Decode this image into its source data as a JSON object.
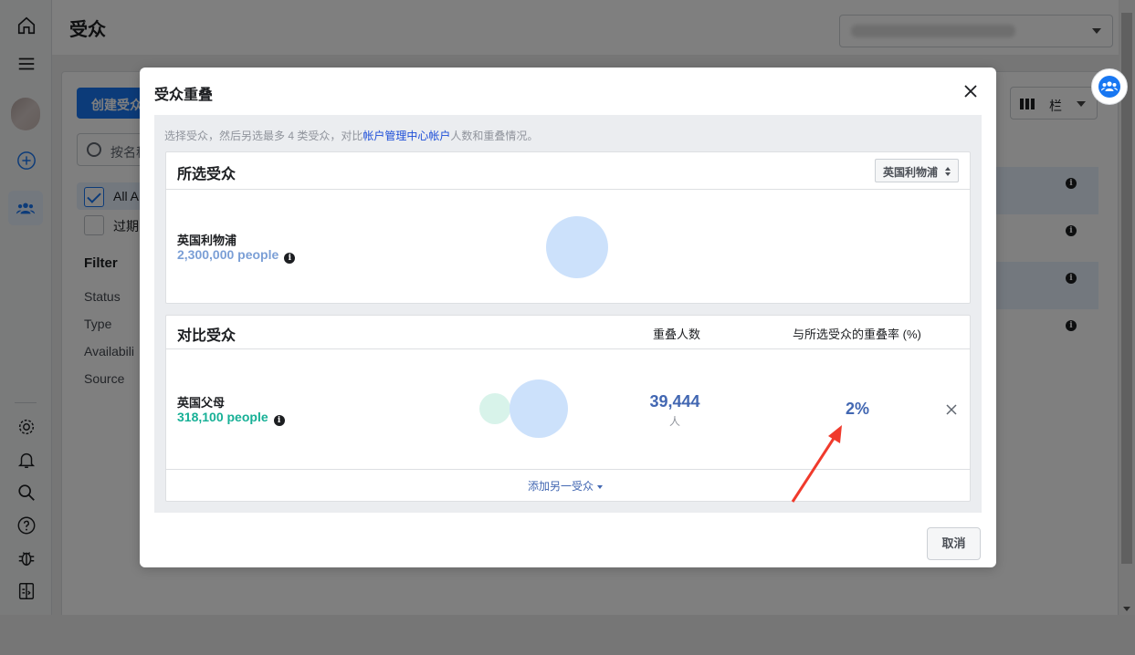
{
  "app": {
    "page_title": "受众",
    "create_button": "创建受众",
    "search_placeholder": "按名称",
    "checkbox_all": "All A",
    "checkbox_expired": "过期",
    "filter_title": "Filter",
    "filters": [
      "Status",
      "Type",
      "Availabili",
      "Source"
    ],
    "columns_label": "栏"
  },
  "modal": {
    "title": "受众重叠",
    "hint_prefix": "选择受众，然后另选最多 4 类受众，对比",
    "hint_link": "帐户管理中心帐户",
    "hint_suffix": "人数和重叠情况。",
    "selected_panel": {
      "title": "所选受众",
      "selector_value": "英国利物浦",
      "audience_name": "英国利物浦",
      "audience_size": "2,300,000 people"
    },
    "compare_panel": {
      "title": "对比受众",
      "col_overlap": "重叠人数",
      "col_rate": "与所选受众的重叠率 (%)",
      "rows": [
        {
          "audience_name": "英国父母",
          "audience_size": "318,100 people",
          "overlap_count": "39,444",
          "overlap_unit": "人",
          "overlap_rate": "2%"
        }
      ],
      "add_link": "添加另一受众"
    },
    "cancel_button": "取消"
  },
  "colors": {
    "primary_blue": "#1877f2",
    "selected_bubble": "#cce1fb",
    "compare_bubble": "#d8f3ea",
    "selected_size_text": "#7b9fd6",
    "compare_size_text": "#17b096",
    "metric_text": "#4267b2",
    "annotation_arrow": "#f03a2c"
  }
}
